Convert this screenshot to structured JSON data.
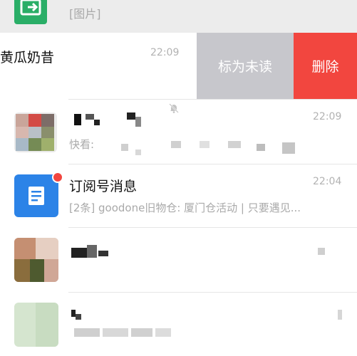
{
  "chat_list": {
    "top_row": {
      "preview": "[图片]"
    },
    "swiped_row": {
      "title": "黄瓜奶昔",
      "time": "22:09",
      "actions": {
        "mark_unread": "标为未读",
        "delete": "删除"
      }
    },
    "group_row": {
      "time": "22:09",
      "preview": "快看: "
    },
    "subscription_row": {
      "title": "订阅号消息",
      "time": "22:04",
      "preview": "[2条] goodone旧物仓: 厦门仓活动 | 只要遇见..."
    }
  },
  "colors": {
    "delete": "#f2463f",
    "mark_unread": "#c7c7cc",
    "subscription_icon": "#2c83e7",
    "unread_dot": "#f2463f",
    "green_app": "#2aae67"
  },
  "icons": {
    "muted": "bell-muted-icon",
    "subscription": "article-icon",
    "green_app": "forward-arrow-icon"
  }
}
